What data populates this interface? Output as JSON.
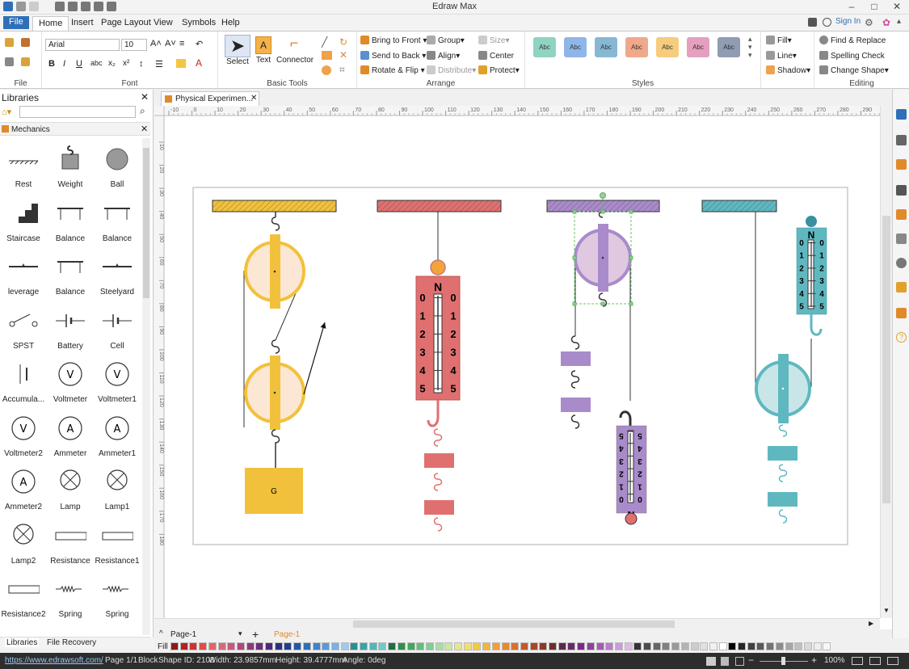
{
  "app": {
    "title": "Edraw Max"
  },
  "menu": {
    "tabs": [
      "File",
      "Home",
      "Insert",
      "Page Layout",
      "View",
      "Symbols",
      "Help"
    ],
    "sign_in": "Sign In"
  },
  "ribbon": {
    "font": {
      "name": "Arial",
      "size": "10",
      "group_label": "Font"
    },
    "file_label": "File",
    "basic_tools": {
      "select": "Select",
      "text": "Text",
      "connector": "Connector",
      "group_label": "Basic Tools"
    },
    "arrange": {
      "bring_front": "Bring to Front",
      "send_back": "Send to Back",
      "rotate": "Rotate & Flip",
      "group": "Group",
      "align": "Align",
      "distribute": "Distribute",
      "size": "Size",
      "center": "Center",
      "protect": "Protect",
      "group_label": "Arrange"
    },
    "styles": {
      "swatch_label": "Abc",
      "fill": "Fill",
      "line": "Line",
      "shadow": "Shadow",
      "group_label": "Styles",
      "colors": [
        "#8fd3c1",
        "#8fb6e8",
        "#86b8d4",
        "#f0a88a",
        "#f7cc7d",
        "#e4a0be",
        "#8f9cb3"
      ]
    },
    "editing": {
      "find": "Find & Replace",
      "spelling": "Spelling Check",
      "change_shape": "Change Shape",
      "group_label": "Editing"
    }
  },
  "libraries": {
    "title": "Libraries",
    "category": "Mechanics",
    "items": [
      "Rest",
      "Weight",
      "Ball",
      "Staircase",
      "Balance",
      "Balance",
      "leverage",
      "Balance",
      "Steelyard",
      "SPST",
      "Battery",
      "Cell",
      "Accumula...",
      "Voltmeter",
      "Voltmeter1",
      "Voltmeter2",
      "Ammeter",
      "Ammeter1",
      "Ammeter2",
      "Lamp",
      "Lamp1",
      "Lamp2",
      "Resistance",
      "Resistance1",
      "Resistance2",
      "Spring",
      "Spring"
    ],
    "bottom_tabs": [
      "Libraries",
      "File Recovery"
    ]
  },
  "document": {
    "tab_title": "Physical Experimen...",
    "page_name": "Page-1",
    "active_page": "Page-1"
  },
  "ruler": {
    "top_labels": [
      "-10",
      "0",
      "10",
      "20",
      "30",
      "40",
      "50",
      "60",
      "70",
      "80",
      "90",
      "100",
      "110",
      "120",
      "130",
      "140",
      "150",
      "160",
      "170",
      "180",
      "190",
      "200",
      "210",
      "220",
      "230",
      "240",
      "250",
      "260",
      "270",
      "280",
      "290"
    ],
    "left_labels": [
      "10",
      "20",
      "30",
      "40",
      "50",
      "60",
      "70",
      "80",
      "90",
      "100",
      "110",
      "120",
      "130",
      "140",
      "150",
      "160",
      "170",
      "180"
    ]
  },
  "diagram": {
    "weight_label": "G",
    "scale_unit": "N",
    "scale_numbers": [
      "0",
      "1",
      "2",
      "3",
      "4",
      "5"
    ],
    "colors": {
      "yellow": "#f2c13b",
      "red": "#e07070",
      "purple": "#a98bcb",
      "teal": "#5fb8c0"
    }
  },
  "fill_label": "Fill",
  "status": {
    "url": "https://www.edrawsoft.com/",
    "page": "Page 1/1",
    "block": "Block",
    "shape_id": "Shape ID: 2108",
    "width": "Width: 23.9857mm",
    "height": "Height: 39.4777mm",
    "angle": "Angle: 0deg",
    "zoom": "100%"
  }
}
